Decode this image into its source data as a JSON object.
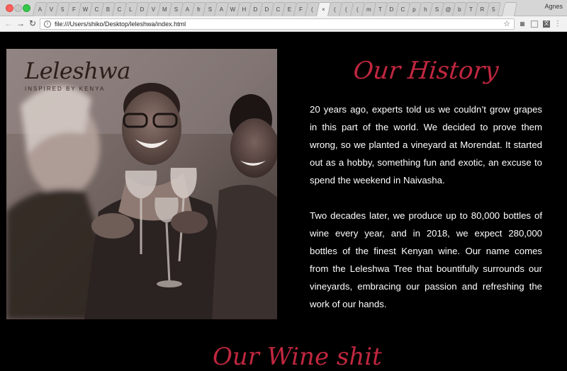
{
  "browser": {
    "tab_labels": [
      "A",
      "V",
      "5",
      "F",
      "W",
      "C",
      "B",
      "C",
      "L",
      "D",
      "V",
      "M",
      "S",
      "A",
      "fr",
      "S",
      "A",
      "W",
      "H",
      "D",
      "D",
      "C",
      "E",
      "F",
      "(",
      "×",
      "(",
      "(",
      "(",
      "m",
      "T",
      "D",
      "C",
      "p",
      "h",
      "S",
      "@",
      "b",
      "T",
      "R",
      "5"
    ],
    "active_tab_index": 25,
    "profile_name": "Agnes",
    "url": "file:///Users/shiko/Desktop/leleshwa/index.html"
  },
  "page": {
    "logo_name": "Leleshwa",
    "logo_tagline": "INSPIRED BY KENYA",
    "section_title": "Our History",
    "paragraphs": [
      "20 years ago, experts told us we couldn’t grow grapes in this part of the world. We decided to prove them wrong, so we planted a vineyard at Morendat. It started out as a hobby, something fun and exotic, an excuse to spend the weekend in Naivasha.",
      "Two decades later, we produce up to 80,000 bottles of wine every year, and in 2018, we expect 280,000 bottles of the finest Kenyan wine. Our name comes from the Leleshwa Tree that bountifully surrounds our vineyards, embracing our passion and refreshing the work of our hands."
    ],
    "next_section_title_partial": "Our Wine shit"
  },
  "colors": {
    "accent": "#c0273f",
    "background": "#000000",
    "text": "#ffffff"
  }
}
